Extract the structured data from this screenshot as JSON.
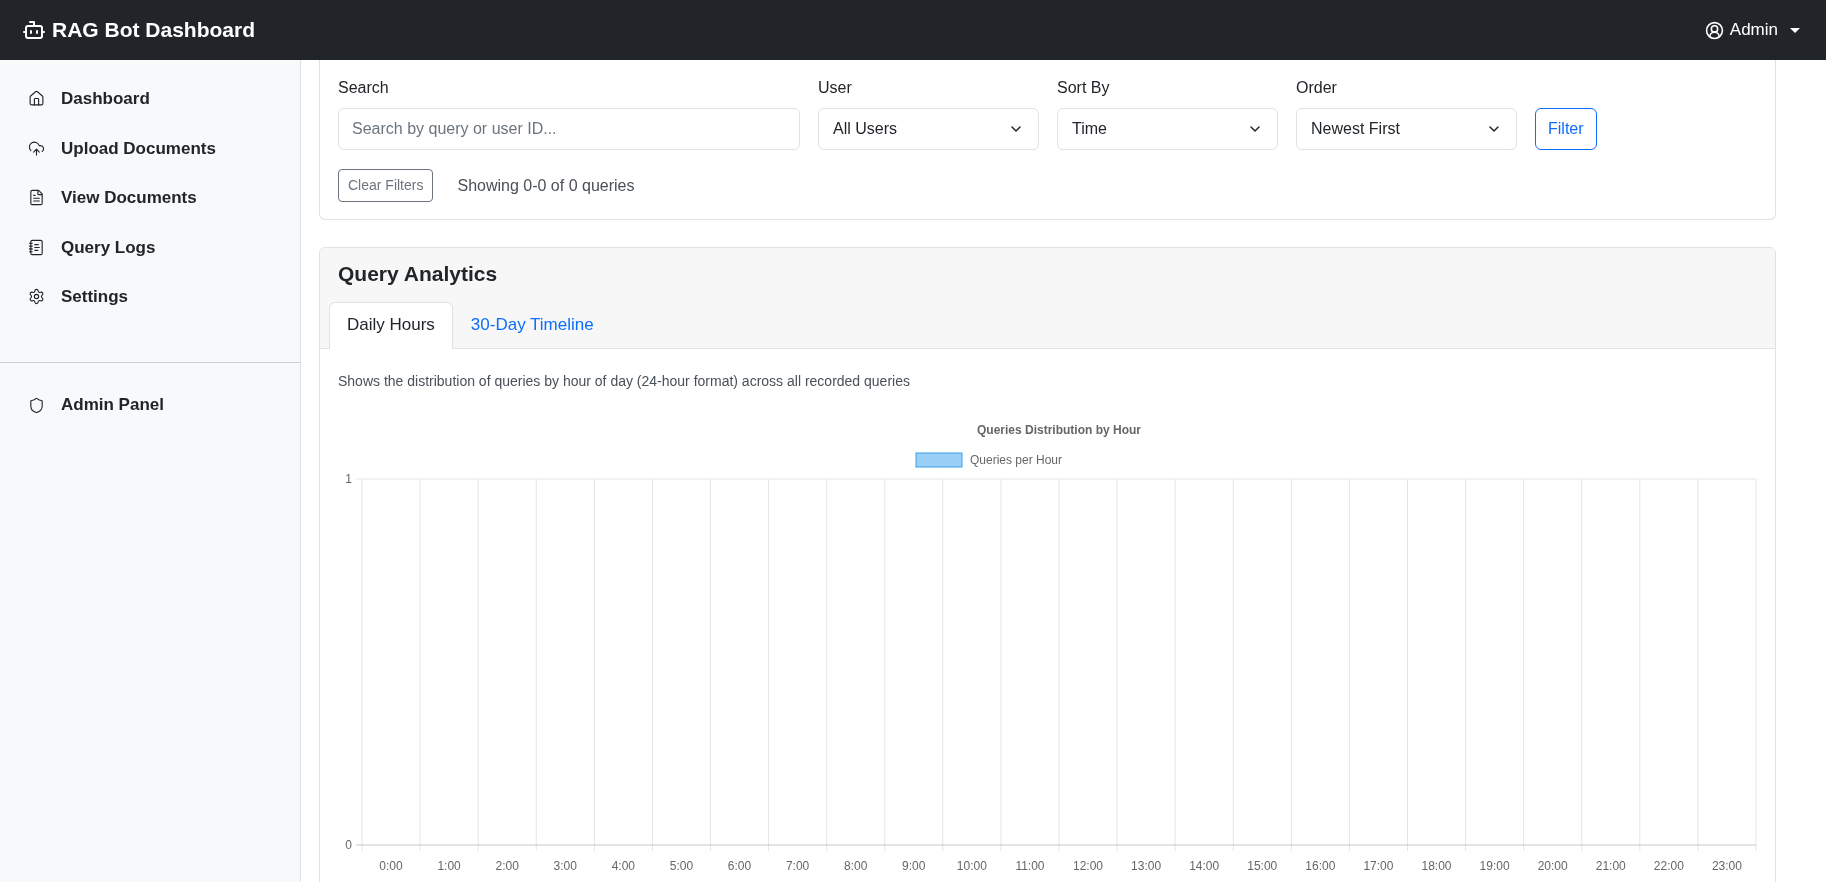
{
  "navbar": {
    "brand": "RAG Bot Dashboard",
    "user": "Admin"
  },
  "sidebar": {
    "items": [
      {
        "label": "Dashboard"
      },
      {
        "label": "Upload Documents"
      },
      {
        "label": "View Documents"
      },
      {
        "label": "Query Logs"
      },
      {
        "label": "Settings"
      }
    ],
    "admin_items": [
      {
        "label": "Admin Panel"
      }
    ]
  },
  "filters": {
    "search": {
      "label": "Search",
      "placeholder": "Search by query or user ID..."
    },
    "selects": [
      {
        "label": "User",
        "value": "All Users"
      },
      {
        "label": "Sort By",
        "value": "Time"
      },
      {
        "label": "Order",
        "value": "Newest First"
      }
    ],
    "filter_button": "Filter",
    "clear_button": "Clear Filters",
    "summary": "Showing 0-0 of 0 queries"
  },
  "analytics": {
    "title": "Query Analytics",
    "tabs": [
      {
        "label": "Daily Hours",
        "selected": true
      },
      {
        "label": "30-Day Timeline",
        "selected": false
      }
    ],
    "description": "Shows the distribution of queries by hour of day (24-hour format) across all recorded queries",
    "chart_data": {
      "type": "bar",
      "title": "Queries Distribution by Hour",
      "categories": [
        "0:00",
        "1:00",
        "2:00",
        "3:00",
        "4:00",
        "5:00",
        "6:00",
        "7:00",
        "8:00",
        "9:00",
        "10:00",
        "11:00",
        "12:00",
        "13:00",
        "14:00",
        "15:00",
        "16:00",
        "17:00",
        "18:00",
        "19:00",
        "20:00",
        "21:00",
        "22:00",
        "23:00"
      ],
      "series": [
        {
          "name": "Queries per Hour",
          "color": "#36a2eb",
          "values": [
            0,
            0,
            0,
            0,
            0,
            0,
            0,
            0,
            0,
            0,
            0,
            0,
            0,
            0,
            0,
            0,
            0,
            0,
            0,
            0,
            0,
            0,
            0,
            0
          ]
        }
      ],
      "ylim": [
        0,
        1
      ],
      "yticks": [
        0,
        1
      ]
    }
  }
}
